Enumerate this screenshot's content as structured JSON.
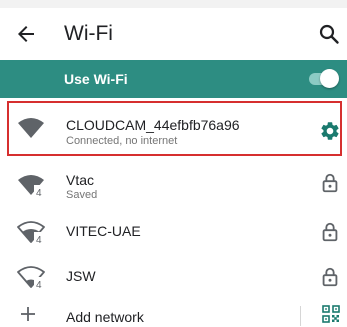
{
  "header": {
    "title": "Wi-Fi",
    "back_icon": "arrow-back-icon",
    "search_icon": "search-icon"
  },
  "use_wifi": {
    "label": "Use Wi-Fi",
    "enabled": true,
    "bar_color": "#2d8d82"
  },
  "networks": [
    {
      "name": "CLOUDCAM_44efbfb76a96",
      "status": "Connected, no internet",
      "icon": "wifi-full-signal-icon",
      "trailing_icon": "settings-gear-icon",
      "highlighted": true
    },
    {
      "name": "Vtac",
      "status": "Saved",
      "icon": "wifi-4-signal-icon",
      "trailing_icon": "lock-icon",
      "badge": "4"
    },
    {
      "name": "VITEC-UAE",
      "status": "",
      "icon": "wifi-4-weak-signal-icon",
      "trailing_icon": "lock-icon",
      "badge": "4"
    },
    {
      "name": "JSW",
      "status": "",
      "icon": "wifi-4-empty-signal-icon",
      "trailing_icon": "lock-icon",
      "badge": "4"
    }
  ],
  "add_network": {
    "label": "Add network",
    "icon": "plus-icon",
    "qr_icon": "qr-code-scan-icon"
  },
  "colors": {
    "accent": "#2d8d82",
    "icon_teal": "#1a7a6e",
    "highlight_border": "#d62f2f"
  }
}
